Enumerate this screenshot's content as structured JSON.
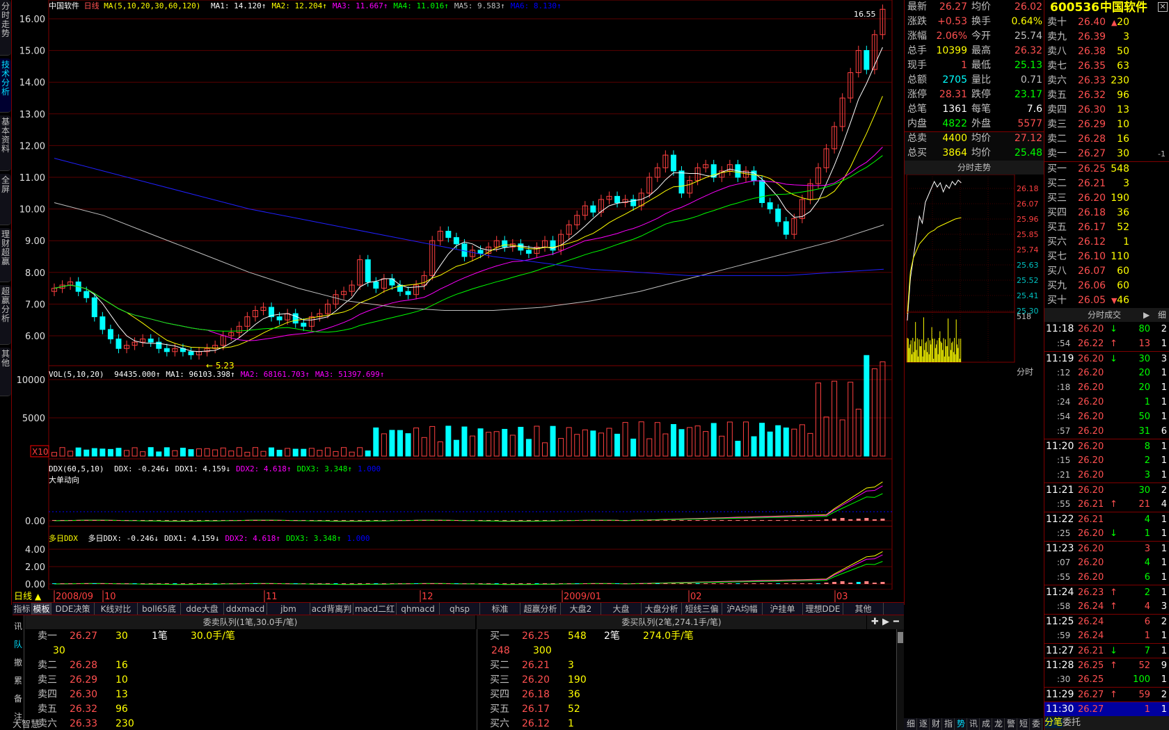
{
  "sidebar": {
    "tabs": [
      "分时走势",
      "技术分析",
      "基本资料",
      "全屏",
      "理财超赢",
      "超赢分析",
      "其他"
    ]
  },
  "chart": {
    "header_name": "中国软件",
    "header_period": "日线",
    "ma_params": "MA(5,10,20,30,60,120)",
    "ma_values": [
      {
        "label": "MA1: 14.120↑",
        "color": "#ffffff"
      },
      {
        "label": "MA2: 12.204↑",
        "color": "#ffff00"
      },
      {
        "label": "MA3: 11.667↑",
        "color": "#ff00ff"
      },
      {
        "label": "MA4: 11.016↑",
        "color": "#00ff00"
      },
      {
        "label": "MA5: 9.583↑",
        "color": "#c0c0c0"
      },
      {
        "label": "MA6: 8.130↑",
        "color": "#0000ff"
      }
    ],
    "price_axis": [
      "16.00",
      "15.00",
      "14.00",
      "13.00",
      "12.00",
      "11.00",
      "10.00",
      "9.00",
      "8.00",
      "7.00",
      "6.00"
    ],
    "low_mark": "5.23",
    "high_mark": "16.55",
    "vol_header": "VOL(5,10,20)",
    "vol_values": [
      {
        "label": "94435.000↑",
        "color": "#ffffff"
      },
      {
        "label": "MA1: 96103.398↑",
        "color": "#ffffff"
      },
      {
        "label": "MA2: 68161.703↑",
        "color": "#ff00ff"
      },
      {
        "label": "MA3: 51397.699↑",
        "color": "#ff00ff"
      }
    ],
    "vol_axis": [
      "10000",
      "5000"
    ],
    "vol_unit": "X10",
    "ddx_header": "DDX(60,5,10)",
    "ddx_values": [
      {
        "label": "DDX: -0.246↓",
        "color": "#ffffff"
      },
      {
        "label": "DDX1: 4.159↓",
        "color": "#ffffff"
      },
      {
        "label": "DDX2: 4.618↑",
        "color": "#ff00ff"
      },
      {
        "label": "DDX3: 3.348↑",
        "color": "#00ff00"
      },
      {
        "label": "1.000",
        "color": "#0000ff"
      }
    ],
    "ddx_sub": "大单动向",
    "ddx_axis": [
      "0.00"
    ],
    "mddx_header": "多日DDX",
    "mddx_values": [
      {
        "label": "多日DDX: -0.246↓",
        "color": "#ffffff"
      },
      {
        "label": "DDX1: 4.159↓",
        "color": "#ffffff"
      },
      {
        "label": "DDX2: 4.618↑",
        "color": "#ff00ff"
      },
      {
        "label": "DDX3: 3.348↑",
        "color": "#00ff00"
      },
      {
        "label": "1.000",
        "color": "#0000ff"
      }
    ],
    "mddx_axis": [
      "4.00",
      "2.00",
      "0.00"
    ],
    "period_label": "日线",
    "date_labels": [
      "2008/09",
      "10",
      "11",
      "12",
      "2009/01",
      "02",
      "03"
    ]
  },
  "bottom_tabs": [
    "指标",
    "模板",
    "DDE决策",
    "K线对比",
    "boll65底",
    "dde大盘",
    "ddxmacd",
    "jbm",
    "acd背离判断",
    "macd二红",
    "qhmacd",
    "qhsp",
    "标准",
    "超赢分析",
    "大盘2",
    "大盘MBSS",
    "大盘分析",
    "短线三偏",
    "沪A均幅",
    "沪挂单",
    "理想DDE",
    "其他"
  ],
  "quote": {
    "rows": [
      {
        "l1": "最新",
        "v1": "26.27",
        "c1": "r",
        "l2": "均价",
        "v2": "26.02",
        "c2": "r"
      },
      {
        "l1": "涨跌",
        "v1": "+0.53",
        "c1": "r",
        "l2": "换手",
        "v2": "0.64%",
        "c2": "y"
      },
      {
        "l1": "涨幅",
        "v1": "2.06%",
        "c1": "r",
        "l2": "今开",
        "v2": "25.74",
        "c2": "gr"
      },
      {
        "l1": "总手",
        "v1": "10399",
        "c1": "y",
        "l2": "最高",
        "v2": "26.32",
        "c2": "r"
      },
      {
        "l1": "现手",
        "v1": "1",
        "c1": "r",
        "l2": "最低",
        "v2": "25.13",
        "c2": "g"
      },
      {
        "l1": "总额",
        "v1": "2705",
        "c1": "c",
        "l2": "量比",
        "v2": "0.71",
        "c2": "gr"
      },
      {
        "l1": "涨停",
        "v1": "28.31",
        "c1": "r",
        "l2": "跌停",
        "v2": "23.17",
        "c2": "g"
      },
      {
        "l1": "总笔",
        "v1": "1361",
        "c1": "w",
        "l2": "每笔",
        "v2": "7.6",
        "c2": "w"
      },
      {
        "l1": "内盘",
        "v1": "4822",
        "c1": "g",
        "l2": "外盘",
        "v2": "5577",
        "c2": "r"
      },
      {
        "l1": "总卖",
        "v1": "4400",
        "c1": "y",
        "l2": "均价",
        "v2": "27.12",
        "c2": "r"
      },
      {
        "l1": "总买",
        "v1": "3864",
        "c1": "y",
        "l2": "均价",
        "v2": "25.48",
        "c2": "g"
      }
    ],
    "mini_title": "分时走势",
    "mini_axis": [
      "26.18",
      "26.07",
      "25.96",
      "25.85",
      "25.74",
      "25.63",
      "25.52",
      "25.41",
      "25.30"
    ],
    "mini_vol": "518",
    "mini_foot": "分时"
  },
  "orderbook": {
    "code": "600536",
    "name": "中国软件",
    "sells": [
      {
        "l": "卖十",
        "p": "26.40",
        "v": "20",
        "arrow": "▲",
        "extra": ""
      },
      {
        "l": "卖九",
        "p": "26.39",
        "v": "3",
        "arrow": "",
        "extra": ""
      },
      {
        "l": "卖八",
        "p": "26.38",
        "v": "50",
        "arrow": "",
        "extra": ""
      },
      {
        "l": "卖七",
        "p": "26.35",
        "v": "63",
        "arrow": "",
        "extra": ""
      },
      {
        "l": "卖六",
        "p": "26.33",
        "v": "230",
        "arrow": "",
        "extra": ""
      },
      {
        "l": "卖五",
        "p": "26.32",
        "v": "96",
        "arrow": "",
        "extra": ""
      },
      {
        "l": "卖四",
        "p": "26.30",
        "v": "13",
        "arrow": "",
        "extra": ""
      },
      {
        "l": "卖三",
        "p": "26.29",
        "v": "10",
        "arrow": "",
        "extra": ""
      },
      {
        "l": "卖二",
        "p": "26.28",
        "v": "16",
        "arrow": "",
        "extra": ""
      },
      {
        "l": "卖一",
        "p": "26.27",
        "v": "30",
        "arrow": "",
        "extra": "-1"
      }
    ],
    "buys": [
      {
        "l": "买一",
        "p": "26.25",
        "v": "548",
        "arrow": ""
      },
      {
        "l": "买二",
        "p": "26.21",
        "v": "3",
        "arrow": ""
      },
      {
        "l": "买三",
        "p": "26.20",
        "v": "190",
        "arrow": ""
      },
      {
        "l": "买四",
        "p": "26.18",
        "v": "36",
        "arrow": ""
      },
      {
        "l": "买五",
        "p": "26.17",
        "v": "52",
        "arrow": ""
      },
      {
        "l": "买六",
        "p": "26.12",
        "v": "1",
        "arrow": ""
      },
      {
        "l": "买七",
        "p": "26.10",
        "v": "110",
        "arrow": ""
      },
      {
        "l": "买八",
        "p": "26.07",
        "v": "60",
        "arrow": ""
      },
      {
        "l": "买九",
        "p": "26.06",
        "v": "60",
        "arrow": ""
      },
      {
        "l": "买十",
        "p": "26.05",
        "v": "46",
        "arrow": "▼"
      }
    ],
    "trades_title": "分时成交",
    "trades_detail": "细",
    "trades": [
      {
        "t": "11:18",
        "p": "26.20",
        "a": "↓",
        "v": "80",
        "n": "2",
        "pc": "r",
        "ac": "g",
        "vc": "g",
        "big": true
      },
      {
        "t": ":54",
        "p": "26.22",
        "a": "↑",
        "v": "13",
        "n": "1",
        "pc": "r",
        "ac": "r",
        "vc": "r",
        "big": false
      },
      {
        "t": "11:19",
        "p": "26.20",
        "a": "↓",
        "v": "30",
        "n": "3",
        "pc": "r",
        "ac": "g",
        "vc": "g",
        "big": true
      },
      {
        "t": ":12",
        "p": "26.20",
        "a": "",
        "v": "20",
        "n": "1",
        "pc": "r",
        "ac": "",
        "vc": "g",
        "big": false
      },
      {
        "t": ":18",
        "p": "26.20",
        "a": "",
        "v": "20",
        "n": "1",
        "pc": "r",
        "ac": "",
        "vc": "g",
        "big": false
      },
      {
        "t": ":24",
        "p": "26.20",
        "a": "",
        "v": "1",
        "n": "1",
        "pc": "r",
        "ac": "",
        "vc": "g",
        "big": false
      },
      {
        "t": ":54",
        "p": "26.20",
        "a": "",
        "v": "50",
        "n": "1",
        "pc": "r",
        "ac": "",
        "vc": "g",
        "big": false
      },
      {
        "t": ":57",
        "p": "26.20",
        "a": "",
        "v": "31",
        "n": "6",
        "pc": "r",
        "ac": "",
        "vc": "g",
        "big": false
      },
      {
        "t": "11:20",
        "p": "26.20",
        "a": "",
        "v": "8",
        "n": "1",
        "pc": "r",
        "ac": "",
        "vc": "g",
        "big": true
      },
      {
        "t": ":15",
        "p": "26.20",
        "a": "",
        "v": "2",
        "n": "1",
        "pc": "r",
        "ac": "",
        "vc": "g",
        "big": false
      },
      {
        "t": ":21",
        "p": "26.20",
        "a": "",
        "v": "3",
        "n": "1",
        "pc": "r",
        "ac": "",
        "vc": "g",
        "big": false
      },
      {
        "t": "11:21",
        "p": "26.20",
        "a": "",
        "v": "30",
        "n": "2",
        "pc": "r",
        "ac": "",
        "vc": "g",
        "big": true
      },
      {
        "t": ":55",
        "p": "26.21",
        "a": "↑",
        "v": "21",
        "n": "4",
        "pc": "r",
        "ac": "r",
        "vc": "r",
        "big": false
      },
      {
        "t": "11:22",
        "p": "26.21",
        "a": "",
        "v": "4",
        "n": "1",
        "pc": "r",
        "ac": "",
        "vc": "g",
        "big": true
      },
      {
        "t": ":25",
        "p": "26.20",
        "a": "↓",
        "v": "1",
        "n": "1",
        "pc": "r",
        "ac": "g",
        "vc": "g",
        "big": false
      },
      {
        "t": "11:23",
        "p": "26.20",
        "a": "",
        "v": "3",
        "n": "1",
        "pc": "r",
        "ac": "",
        "vc": "r",
        "big": true
      },
      {
        "t": ":07",
        "p": "26.20",
        "a": "",
        "v": "4",
        "n": "1",
        "pc": "r",
        "ac": "",
        "vc": "g",
        "big": false
      },
      {
        "t": ":55",
        "p": "26.20",
        "a": "",
        "v": "6",
        "n": "1",
        "pc": "r",
        "ac": "",
        "vc": "g",
        "big": false
      },
      {
        "t": "11:24",
        "p": "26.23",
        "a": "↑",
        "v": "2",
        "n": "1",
        "pc": "r",
        "ac": "r",
        "vc": "g",
        "big": true
      },
      {
        "t": ":58",
        "p": "26.24",
        "a": "↑",
        "v": "4",
        "n": "3",
        "pc": "r",
        "ac": "r",
        "vc": "r",
        "big": false
      },
      {
        "t": "11:25",
        "p": "26.24",
        "a": "",
        "v": "6",
        "n": "2",
        "pc": "r",
        "ac": "",
        "vc": "r",
        "big": true
      },
      {
        "t": ":59",
        "p": "26.24",
        "a": "",
        "v": "1",
        "n": "1",
        "pc": "r",
        "ac": "",
        "vc": "r",
        "big": false
      },
      {
        "t": "11:27",
        "p": "26.21",
        "a": "↓",
        "v": "7",
        "n": "1",
        "pc": "r",
        "ac": "g",
        "vc": "g",
        "big": true
      },
      {
        "t": "11:28",
        "p": "26.25",
        "a": "↑",
        "v": "52",
        "n": "9",
        "pc": "r",
        "ac": "r",
        "vc": "r",
        "big": true
      },
      {
        "t": ":30",
        "p": "26.25",
        "a": "",
        "v": "100",
        "n": "1",
        "pc": "r",
        "ac": "",
        "vc": "g",
        "big": false
      },
      {
        "t": "11:29",
        "p": "26.27",
        "a": "↑",
        "v": "59",
        "n": "2",
        "pc": "r",
        "ac": "r",
        "vc": "r",
        "big": true
      },
      {
        "t": "11:30",
        "p": "26.27",
        "a": "",
        "v": "1",
        "n": "1",
        "pc": "r",
        "ac": "",
        "vc": "r",
        "big": true
      }
    ],
    "bottom_tabs": [
      "分笔",
      "委托"
    ]
  },
  "side_tabs_right": [
    "细",
    "逐",
    "财",
    "指",
    "势",
    "讯",
    "成",
    "龙",
    "警",
    "短",
    "委"
  ],
  "queue": {
    "sell_header": "委卖队列(1笔,30.0手/笔)",
    "buy_header": "委买队列(2笔,274.1手/笔)",
    "left_tabs": [
      "讯",
      "队",
      "撤",
      "累",
      "备",
      "注"
    ],
    "sell_rows": [
      {
        "l": "卖一",
        "p": "26.27",
        "v": "30",
        "x": "1笔",
        "y": "30.0手/笔"
      },
      {
        "l": "",
        "p": "",
        "v": "30",
        "x": "",
        "y": ""
      },
      {
        "l": "卖二",
        "p": "26.28",
        "v": "16",
        "x": "",
        "y": ""
      },
      {
        "l": "卖三",
        "p": "26.29",
        "v": "10",
        "x": "",
        "y": ""
      },
      {
        "l": "卖四",
        "p": "26.30",
        "v": "13",
        "x": "",
        "y": ""
      },
      {
        "l": "卖五",
        "p": "26.32",
        "v": "96",
        "x": "",
        "y": ""
      },
      {
        "l": "卖六",
        "p": "26.33",
        "v": "230",
        "x": "",
        "y": ""
      }
    ],
    "buy_rows": [
      {
        "l": "买一",
        "p": "26.25",
        "v": "548",
        "x": "2笔",
        "y": "274.0手/笔"
      },
      {
        "l": "",
        "p": "248",
        "v": "300",
        "x": "",
        "y": ""
      },
      {
        "l": "买二",
        "p": "26.21",
        "v": "3",
        "x": "",
        "y": ""
      },
      {
        "l": "买三",
        "p": "26.20",
        "v": "190",
        "x": "",
        "y": ""
      },
      {
        "l": "买四",
        "p": "26.18",
        "v": "36",
        "x": "",
        "y": ""
      },
      {
        "l": "买五",
        "p": "26.17",
        "v": "52",
        "x": "",
        "y": ""
      },
      {
        "l": "买六",
        "p": "26.12",
        "v": "1",
        "x": "",
        "y": ""
      }
    ],
    "watermark": "大智慧"
  }
}
